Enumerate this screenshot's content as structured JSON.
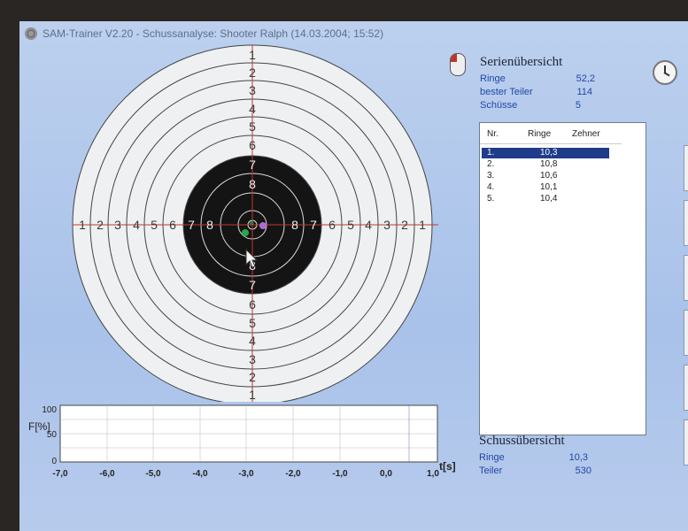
{
  "window": {
    "title": "SAM-Trainer V2.20 - Schussanalyse: Shooter Ralph (14.03.2004; 15:52)"
  },
  "target": {
    "ring_numbers_left": [
      "1",
      "2",
      "3",
      "4",
      "5",
      "6",
      "7",
      "8"
    ],
    "ring_numbers_right": [
      "8",
      "7",
      "6",
      "5",
      "4",
      "3",
      "2",
      "1"
    ],
    "ring_numbers_top": [
      "1",
      "2",
      "3",
      "4",
      "5",
      "6",
      "7",
      "8"
    ],
    "ring_numbers_bottom": [
      "8",
      "7",
      "6",
      "5",
      "4",
      "3",
      "2",
      "1"
    ],
    "colors": {
      "paper": "#eef0f2",
      "black_area": "#141414",
      "crosshair": "#c0392b",
      "shot_green": "#2da44e",
      "shot_purple": "#b06ad6"
    }
  },
  "force_chart": {
    "ylabel": "F[%]",
    "xlabel": "t[s]",
    "y_ticks": [
      "100",
      "50",
      "0"
    ],
    "x_ticks": [
      "-7,0",
      "-6,0",
      "-5,0",
      "-4,0",
      "-3,0",
      "-2,0",
      "-1,0",
      "0,0",
      "1,0"
    ]
  },
  "series_overview": {
    "title": "Serienübersicht",
    "rows": [
      {
        "label": "Ringe",
        "value": "52,2"
      },
      {
        "label": "bester Teiler",
        "value": "114"
      },
      {
        "label": "Schüsse",
        "value": "5"
      }
    ]
  },
  "shot_table": {
    "headers": [
      "Nr.",
      "Ringe",
      "Zehner"
    ],
    "rows": [
      {
        "nr": "1.",
        "ringe": "10,3"
      },
      {
        "nr": "2.",
        "ringe": "10,8"
      },
      {
        "nr": "3.",
        "ringe": "10,6"
      },
      {
        "nr": "4.",
        "ringe": "10,1"
      },
      {
        "nr": "5.",
        "ringe": "10,4"
      }
    ],
    "selected_index": 0
  },
  "shot_overview": {
    "title": "Schussübersicht",
    "rows": [
      {
        "label": "Ringe",
        "value": "10,3"
      },
      {
        "label": "Teiler",
        "value": "530"
      }
    ]
  },
  "icons": {
    "app": "target-app-icon",
    "mouse": "mouse-icon",
    "clock": "clock-icon",
    "cursor": "cursor-arrow-icon"
  }
}
